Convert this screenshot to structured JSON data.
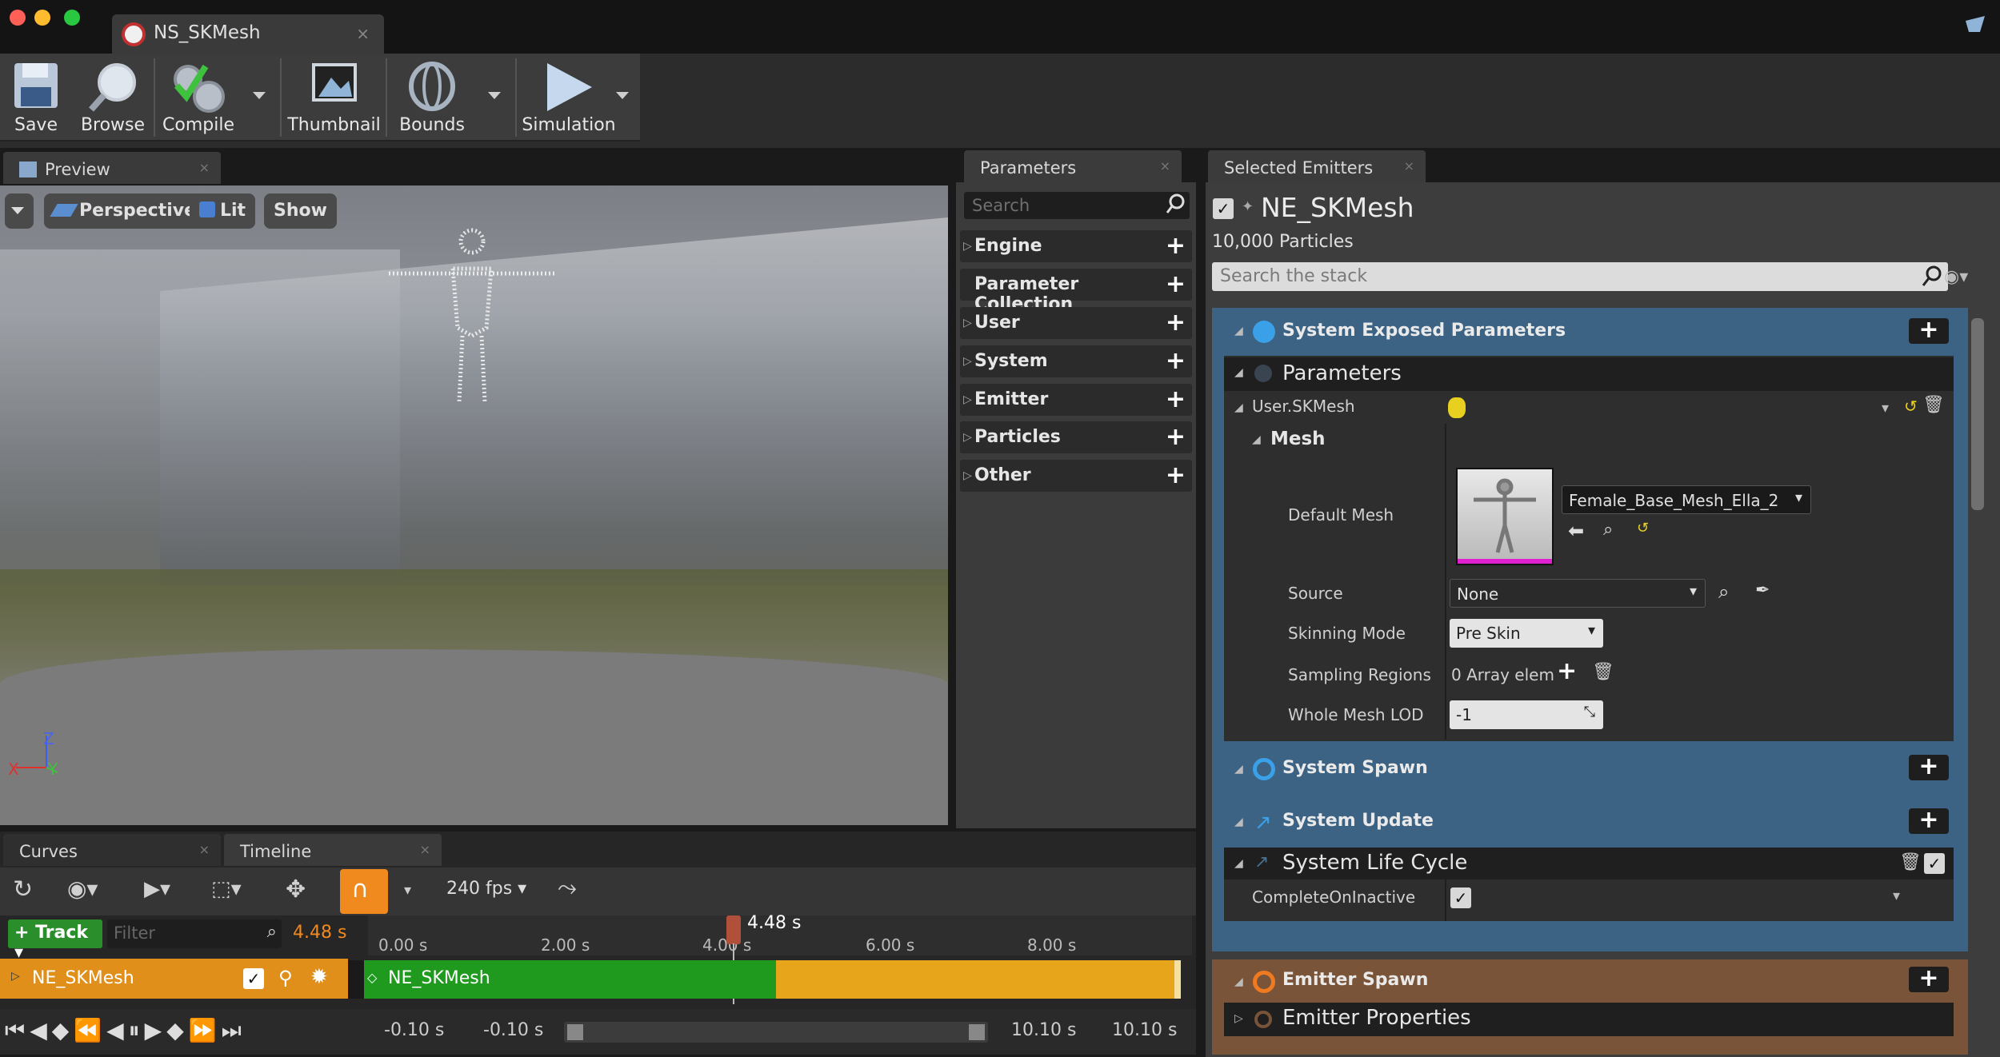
{
  "window": {
    "document_tab": "NS_SKMesh"
  },
  "toolbar": {
    "save": "Save",
    "browse": "Browse",
    "compile": "Compile",
    "thumbnail": "Thumbnail",
    "bounds": "Bounds",
    "simulation": "Simulation"
  },
  "preview": {
    "tab": "Preview",
    "perspective": "Perspective",
    "lit": "Lit",
    "show": "Show",
    "axis_z": "Z",
    "axis_x": "X",
    "axis_y": "Y"
  },
  "parameters": {
    "tab": "Parameters",
    "search_placeholder": "Search",
    "categories": [
      "Engine",
      "Parameter Collection",
      "User",
      "System",
      "Emitter",
      "Particles",
      "Other"
    ]
  },
  "selected_emitters": {
    "tab": "Selected Emitters",
    "emitter_name": "NE_SKMesh",
    "particles": "10,000 Particles",
    "search_placeholder": "Search the stack",
    "system_exposed": "System Exposed Parameters",
    "parameters_header": "Parameters",
    "user_param": "User.SKMesh",
    "mesh_group": "Mesh",
    "default_mesh_label": "Default Mesh",
    "default_mesh_value": "Female_Base_Mesh_Ella_2",
    "source_label": "Source",
    "source_value": "None",
    "skinning_label": "Skinning Mode",
    "skinning_value": "Pre Skin",
    "sampling_label": "Sampling Regions",
    "sampling_value": "0 Array elem",
    "lod_label": "Whole Mesh LOD",
    "lod_value": "-1",
    "system_spawn": "System Spawn",
    "system_update": "System Update",
    "system_life_cycle": "System Life Cycle",
    "complete_on_inactive": "CompleteOnInactive",
    "emitter_spawn": "Emitter Spawn",
    "emitter_properties": "Emitter Properties"
  },
  "timeline": {
    "curves_tab": "Curves",
    "timeline_tab": "Timeline",
    "fps": "240 fps",
    "track_button": "Track",
    "filter_placeholder": "Filter",
    "current_time": "4.48 s",
    "playhead": "4.48 s",
    "ticks": [
      "0.00 s",
      "2.00 s",
      "4.00 s",
      "6.00 s",
      "8.00 s"
    ],
    "track_name": "NE_SKMesh",
    "section_name": "NE_SKMesh",
    "range_start_1": "-0.10 s",
    "range_start_2": "-0.10 s",
    "range_end_1": "10.10 s",
    "range_end_2": "10.10 s"
  },
  "colors": {
    "system_section": "#3d6384",
    "emitter_section": "#7a5438",
    "track_orange": "#e08f1a",
    "section_green": "#1f9a1f",
    "section_yellow": "#e6a51a"
  }
}
